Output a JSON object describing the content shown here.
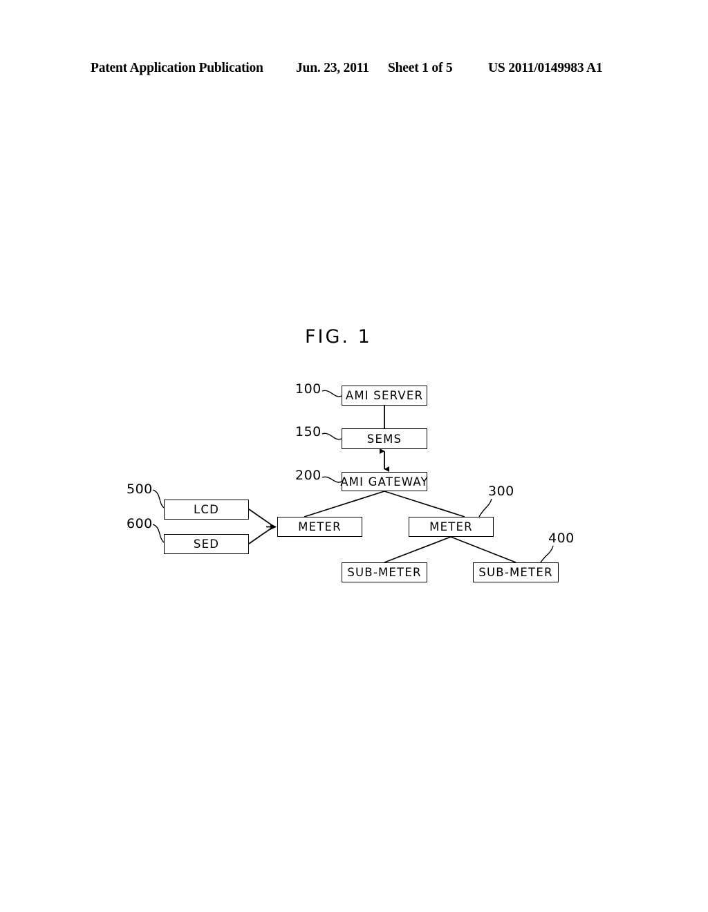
{
  "header": {
    "publication": "Patent Application Publication",
    "date": "Jun. 23, 2011",
    "sheet": "Sheet 1 of 5",
    "number": "US 2011/0149983 A1"
  },
  "figure": {
    "title": "FIG. 1",
    "nodes": [
      {
        "id": "ami-server",
        "label": "AMI SERVER",
        "ref": "100"
      },
      {
        "id": "sems",
        "label": "SEMS",
        "ref": "150"
      },
      {
        "id": "ami-gateway",
        "label": "AMI GATEWAY",
        "ref": "200"
      },
      {
        "id": "meter-left",
        "label": "METER",
        "ref": ""
      },
      {
        "id": "meter-right",
        "label": "METER",
        "ref": "300"
      },
      {
        "id": "submeter-left",
        "label": "SUB-METER",
        "ref": ""
      },
      {
        "id": "submeter-right",
        "label": "SUB-METER",
        "ref": "400"
      },
      {
        "id": "lcd",
        "label": "LCD",
        "ref": "500"
      },
      {
        "id": "sed",
        "label": "SED",
        "ref": "600"
      }
    ],
    "reference_numerals": {
      "ami_server": "100",
      "sems": "150",
      "ami_gateway": "200",
      "meter": "300",
      "sub_meter": "400",
      "lcd": "500",
      "sed": "600"
    },
    "line_color": "#000000"
  }
}
